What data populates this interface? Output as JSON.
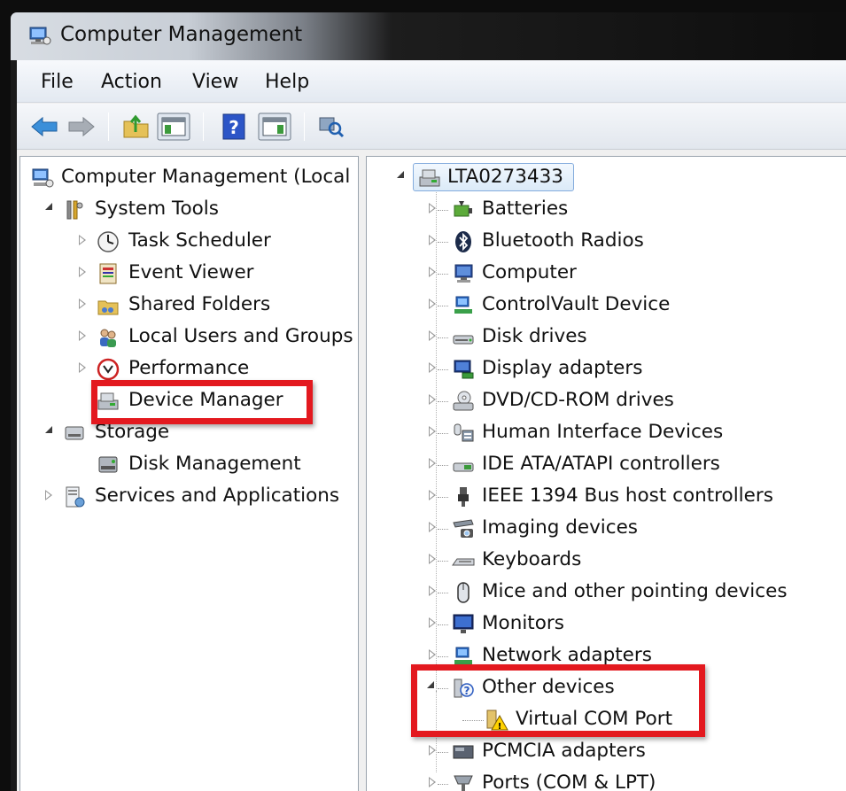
{
  "window": {
    "title": "Computer Management"
  },
  "menu": [
    "File",
    "Action",
    "View",
    "Help"
  ],
  "toolbar": {
    "buttons": [
      "back-icon",
      "forward-icon",
      "up-folder-icon",
      "show-hide-console-tree-icon",
      "help-icon",
      "show-hide-action-pane-icon",
      "scan-hardware-icon"
    ]
  },
  "left_tree": {
    "root": "Computer Management (Local",
    "system_tools": "System Tools",
    "task_scheduler": "Task Scheduler",
    "event_viewer": "Event Viewer",
    "shared_folders": "Shared Folders",
    "local_users": "Local Users and Groups",
    "performance": "Performance",
    "device_manager": "Device Manager",
    "storage": "Storage",
    "disk_management": "Disk Management",
    "services": "Services and Applications"
  },
  "right_tree": {
    "computer_name": "LTA0273433",
    "categories": [
      "Batteries",
      "Bluetooth Radios",
      "Computer",
      "ControlVault Device",
      "Disk drives",
      "Display adapters",
      "DVD/CD-ROM drives",
      "Human Interface Devices",
      "IDE ATA/ATAPI controllers",
      "IEEE 1394 Bus host controllers",
      "Imaging devices",
      "Keyboards",
      "Mice and other pointing devices",
      "Monitors",
      "Network adapters",
      "Other devices",
      "Virtual COM Port",
      "PCMCIA adapters",
      "Ports (COM & LPT)"
    ]
  },
  "colors": {
    "highlight": "#e3191f",
    "selection_border": "#84acdd"
  }
}
